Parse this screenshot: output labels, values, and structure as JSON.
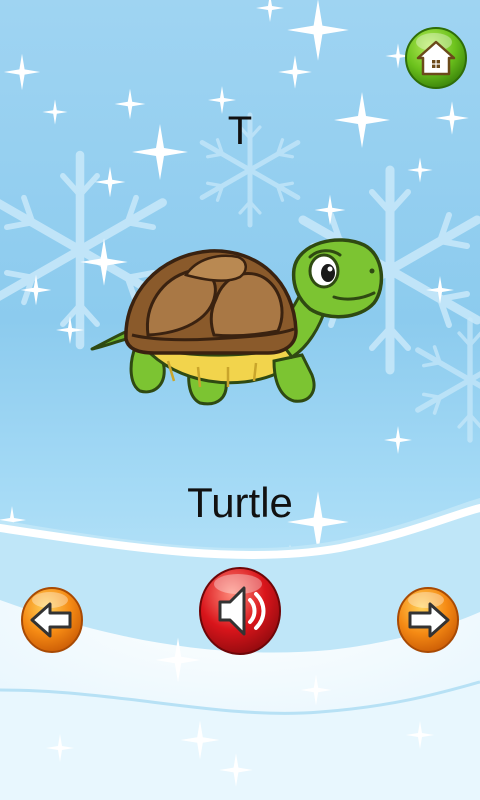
{
  "card": {
    "letter": "T",
    "word": "Turtle"
  },
  "icons": {
    "home": "home-icon",
    "previous": "arrow-left-icon",
    "next": "arrow-right-icon",
    "sound": "speaker-icon",
    "illustration": "turtle-illustration"
  },
  "colors": {
    "sky": "#9fd4f2",
    "home_button": "#6cc21d",
    "nav_button": "#f58a14",
    "sound_button": "#d9151b"
  }
}
